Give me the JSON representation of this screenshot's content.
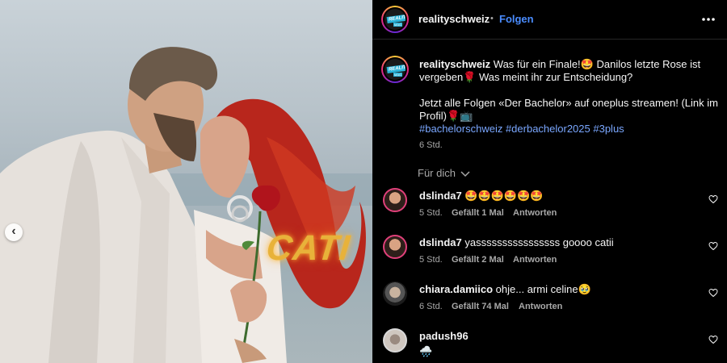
{
  "post": {
    "overlay_text": "CATI",
    "carousel_prev_icon": "chevron-left-icon"
  },
  "header": {
    "username": "realityschweiz",
    "separator": "•",
    "follow_label": "Folgen",
    "more_icon": "more-horizontal-icon"
  },
  "caption": {
    "username": "realityschweiz",
    "text_line1": "Was für ein Finale!🤩 Danilos letzte Rose ist vergeben🌹 Was meint ihr zur Entscheidung?",
    "text_line2": "Jetzt alle Folgen «Der Bachelor» auf oneplus streamen! (Link im Profil)🌹📺",
    "hashtags": "#bachelorschweiz #derbachelor2025 #3plus",
    "time": "6 Std."
  },
  "filter": {
    "label": "Für dich",
    "icon": "chevron-down-icon"
  },
  "comments": [
    {
      "username": "dslinda7",
      "text": "🤩🤩🤩🤩🤩🤩",
      "time": "5 Std.",
      "likes": "Gefällt 1 Mal",
      "reply": "Antworten"
    },
    {
      "username": "dslinda7",
      "text": "yassssssssssssssss goooo catii",
      "time": "5 Std.",
      "likes": "Gefällt 2 Mal",
      "reply": "Antworten"
    },
    {
      "username": "chiara.damiico",
      "text": "ohje... armi celine🥹",
      "time": "6 Std.",
      "likes": "Gefällt 74 Mal",
      "reply": "Antworten"
    },
    {
      "username": "padush96",
      "text": "🌧️",
      "time": "",
      "likes": "",
      "reply": ""
    }
  ],
  "colors": {
    "accent": "#4a8cff",
    "hashtag": "#7aa7ff",
    "overlay": "#e8b23a"
  }
}
